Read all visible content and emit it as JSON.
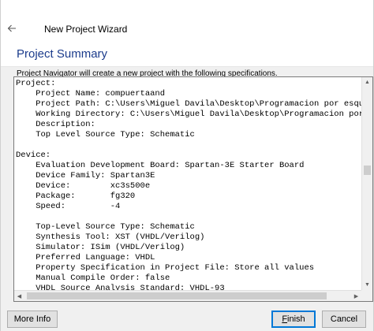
{
  "window": {
    "title": "New Project Wizard"
  },
  "page": {
    "title": "Project Summary",
    "description": "Project Navigator will create a new project with the following specifications."
  },
  "summary_lines": [
    "Project:",
    "    Project Name: compuertaand",
    "    Project Path: C:\\Users\\Miguel Davila\\Desktop\\Programacion por esquem",
    "    Working Directory: C:\\Users\\Miguel Davila\\Desktop\\Programacion por e",
    "    Description:",
    "    Top Level Source Type: Schematic",
    "",
    "Device:",
    "    Evaluation Development Board: Spartan-3E Starter Board",
    "    Device Family: Spartan3E",
    "    Device:        xc3s500e",
    "    Package:       fg320",
    "    Speed:         -4",
    "",
    "    Top-Level Source Type: Schematic",
    "    Synthesis Tool: XST (VHDL/Verilog)",
    "    Simulator: ISim (VHDL/Verilog)",
    "    Preferred Language: VHDL",
    "    Property Specification in Project File: Store all values",
    "    Manual Compile Order: false",
    "    VHDL Source Analysis Standard: VHDL-93"
  ],
  "buttons": {
    "more_info": "More Info",
    "finish_first": "F",
    "finish_rest": "inish",
    "cancel": "Cancel"
  },
  "icons": {
    "back": "back-arrow-icon"
  },
  "colors": {
    "title_blue": "#1c3c8c",
    "default_button_border": "#0078d7"
  }
}
